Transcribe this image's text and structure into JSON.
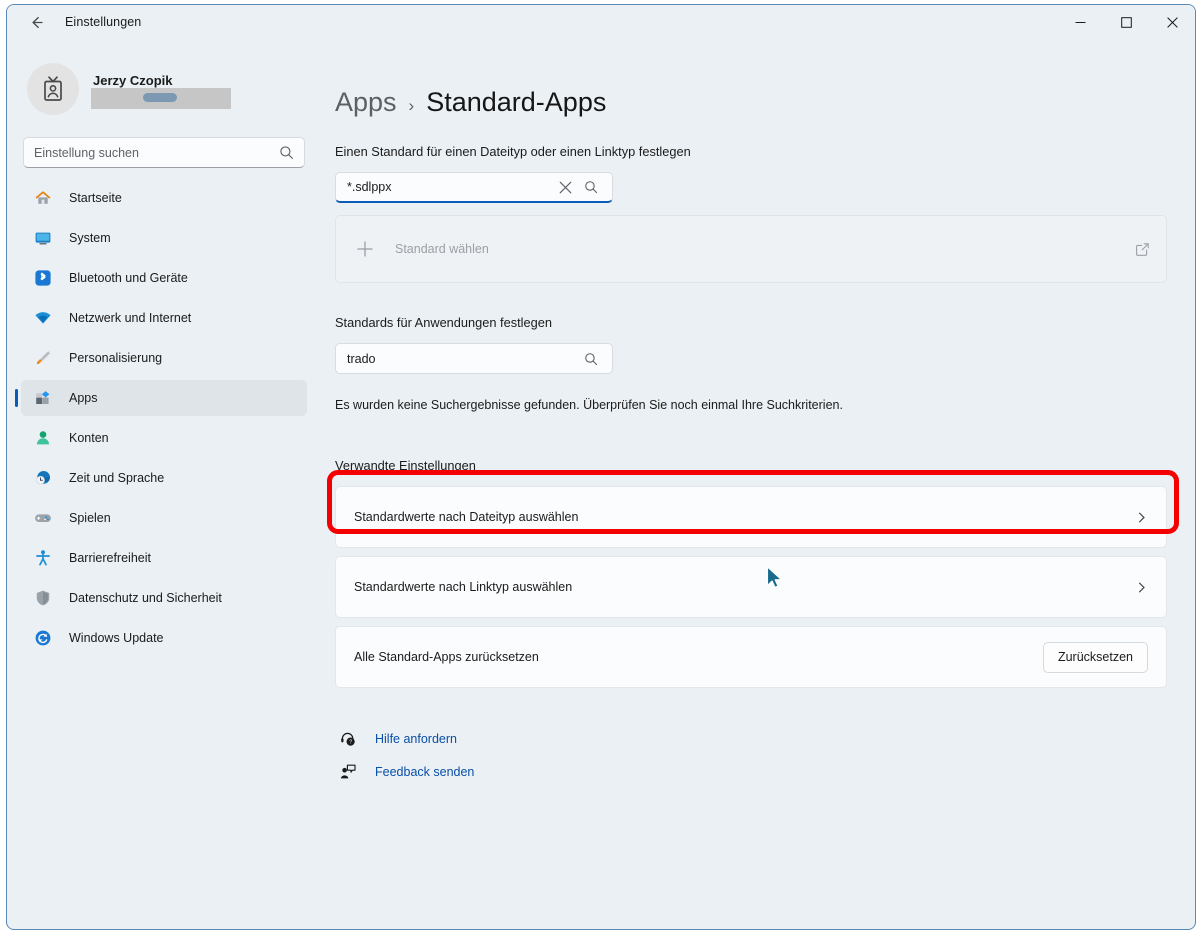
{
  "window": {
    "app_title": "Einstellungen",
    "back_icon": "arrow-left-icon",
    "minimize_label": "—",
    "maximize_label": "□",
    "close_label": "×"
  },
  "sidebar": {
    "profile": {
      "name": "Jerzy Czopik",
      "email": "",
      "avatar_icon": "id-badge-icon"
    },
    "search": {
      "placeholder": "Einstellung suchen",
      "icon": "search-icon"
    },
    "items": [
      {
        "label": "Startseite",
        "icon": "home-icon",
        "selected": false
      },
      {
        "label": "System",
        "icon": "monitor-icon",
        "selected": false
      },
      {
        "label": "Bluetooth und Geräte",
        "icon": "bluetooth-icon",
        "selected": false
      },
      {
        "label": "Netzwerk und Internet",
        "icon": "wifi-icon",
        "selected": false
      },
      {
        "label": "Personalisierung",
        "icon": "paintbrush-icon",
        "selected": false
      },
      {
        "label": "Apps",
        "icon": "apps-icon",
        "selected": true
      },
      {
        "label": "Konten",
        "icon": "person-icon",
        "selected": false
      },
      {
        "label": "Zeit und Sprache",
        "icon": "clock-globe-icon",
        "selected": false
      },
      {
        "label": "Spielen",
        "icon": "gamepad-icon",
        "selected": false
      },
      {
        "label": "Barrierefreiheit",
        "icon": "accessibility-icon",
        "selected": false
      },
      {
        "label": "Datenschutz und Sicherheit",
        "icon": "shield-icon",
        "selected": false
      },
      {
        "label": "Windows Update",
        "icon": "update-icon",
        "selected": false
      }
    ]
  },
  "main": {
    "breadcrumb": {
      "parent": "Apps",
      "separator": "›",
      "current": "Standard-Apps"
    },
    "filetype_section": {
      "label": "Einen Standard für einen Dateityp oder einen Linktyp festlegen",
      "search_value": "*.sdlppx",
      "clear_icon": "close-icon",
      "search_icon": "search-icon",
      "choose_default": {
        "plus_icon": "plus-icon",
        "placeholder": "Standard wählen",
        "external_icon": "external-link-icon"
      }
    },
    "app_section": {
      "label": "Standards für Anwendungen festlegen",
      "search_value": "trado",
      "search_icon": "search-icon",
      "no_results": "Es wurden keine Suchergebnisse gefunden. Überprüfen Sie noch einmal Ihre Suchkriterien."
    },
    "related_section": {
      "label": "Verwandte Einstellungen",
      "rows": [
        {
          "label": "Standardwerte nach Dateityp auswählen",
          "trailing": "chevron-right-icon",
          "highlighted": true
        },
        {
          "label": "Standardwerte nach Linktyp auswählen",
          "trailing": "chevron-right-icon",
          "highlighted": false
        },
        {
          "label": "Alle Standard-Apps zurücksetzen",
          "trailing": "button",
          "button_label": "Zurücksetzen",
          "highlighted": false
        }
      ]
    },
    "links": [
      {
        "label": "Hilfe anfordern",
        "icon": "help-icon"
      },
      {
        "label": "Feedback senden",
        "icon": "feedback-icon"
      }
    ]
  },
  "annotation": {
    "highlight_color": "#f50000",
    "cursor_icon": "mouse-pointer-icon"
  }
}
